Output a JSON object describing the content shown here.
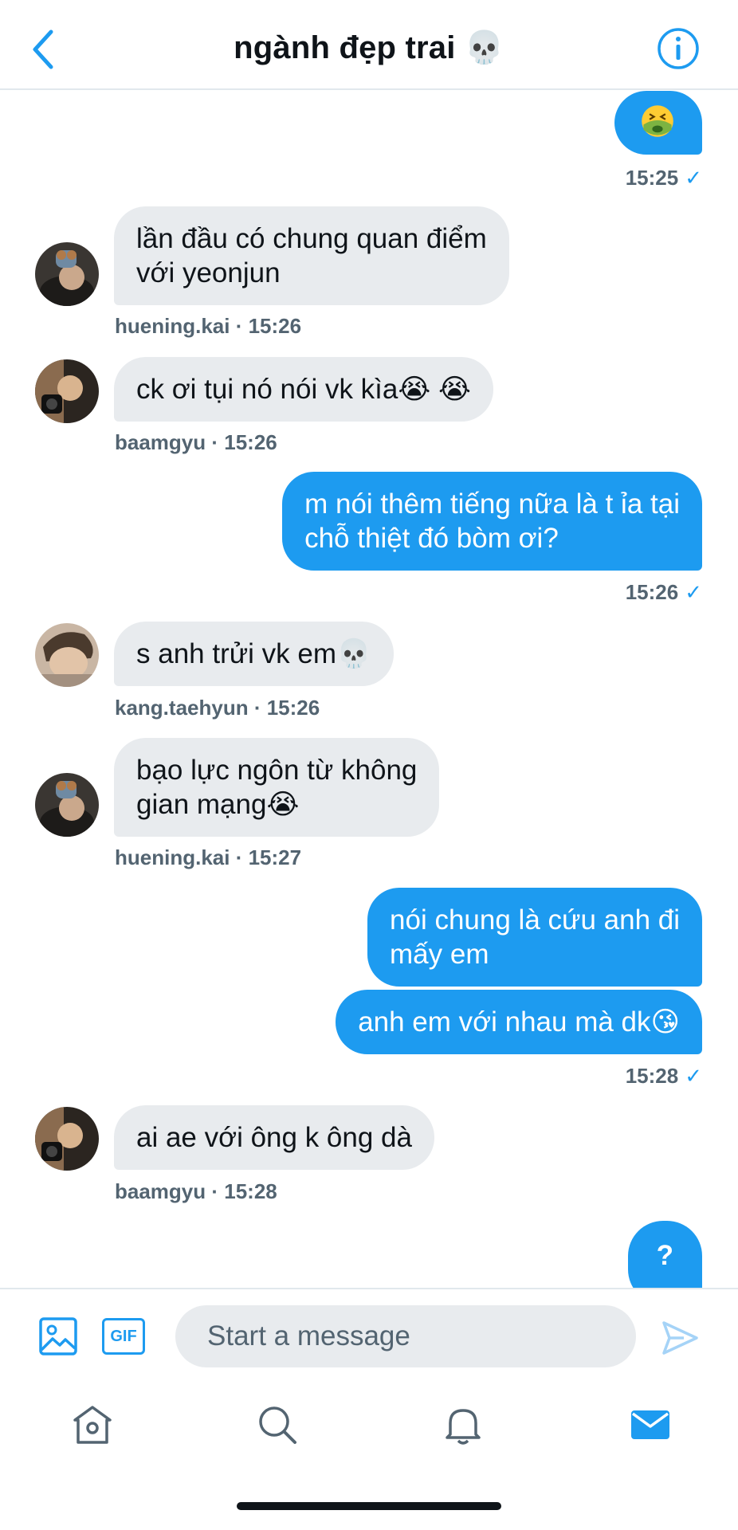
{
  "header": {
    "title": "ngành đẹp trai 💀",
    "back_icon": "chevron-left-icon",
    "info_icon": "info-icon"
  },
  "messages": [
    {
      "dir": "out",
      "text": "🤮",
      "time": "15:25"
    },
    {
      "dir": "in",
      "user": "huening.kai",
      "text": "lần đầu có chung quan điểm\nvới yeonjun",
      "time": "15:26"
    },
    {
      "dir": "in",
      "user": "baamgyu",
      "text": "ck ơi tụi nó nói vk kìa😭 😭",
      "time": "15:26"
    },
    {
      "dir": "out",
      "text": "m nói thêm tiếng nữa là t ỉa tại\nchỗ thiệt đó bòm ơi?",
      "time": "15:26"
    },
    {
      "dir": "in",
      "user": "kang.taehyun",
      "text": "s anh trửi vk em💀",
      "time": "15:26"
    },
    {
      "dir": "in",
      "user": "huening.kai",
      "text": "bạo lực ngôn từ không\ngian mạng😭",
      "time": "15:27"
    },
    {
      "dir": "out",
      "text": "nói chung là cứu anh đi\nmấy em",
      "time": ""
    },
    {
      "dir": "out",
      "text": "anh em với nhau mà dk😘",
      "time": "15:28"
    },
    {
      "dir": "in",
      "user": "baamgyu",
      "text": "ai ae với ông k ông dà",
      "time": "15:28"
    },
    {
      "dir": "out",
      "text": "?",
      "time": ""
    }
  ],
  "meta": {
    "sep": " · ",
    "check": "✓"
  },
  "composer": {
    "placeholder": "Start a message",
    "gif_label": "GIF",
    "media_icon": "image-icon",
    "send_icon": "send-icon"
  },
  "tabbar": {
    "items": [
      "home-icon",
      "search-icon",
      "bell-icon",
      "mail-icon"
    ],
    "active": "mail-icon"
  },
  "colors": {
    "accent": "#1d9bf0",
    "bubble_in": "#e8ebee",
    "meta_text": "#536471"
  }
}
